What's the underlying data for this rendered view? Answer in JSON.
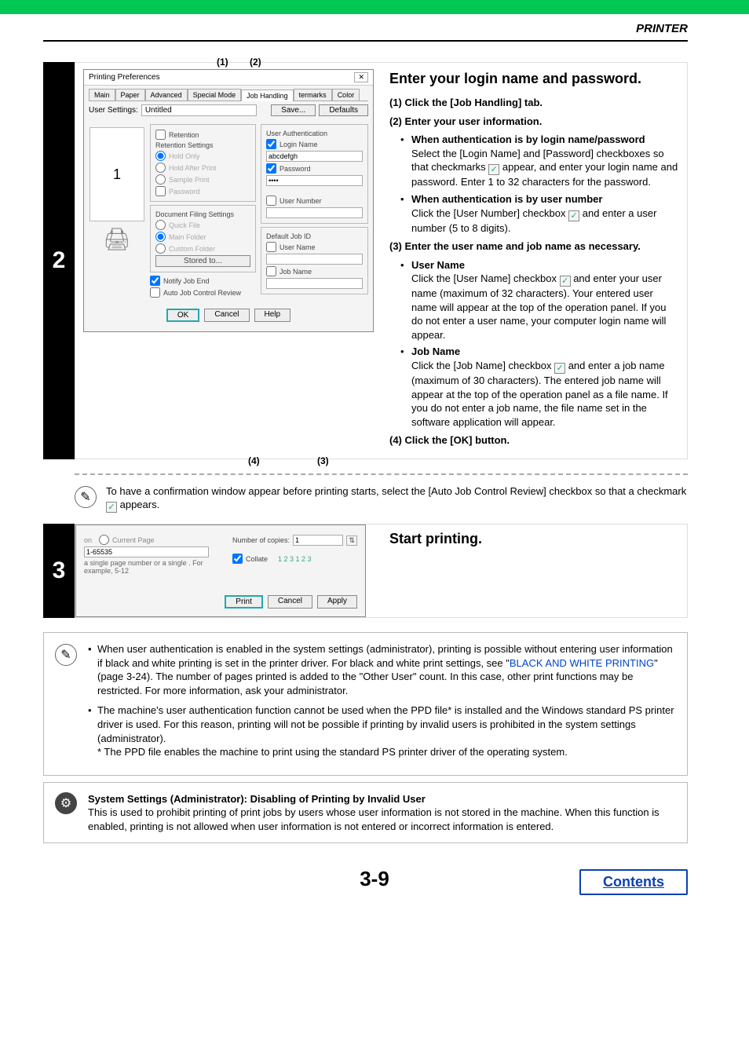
{
  "header": {
    "section": "PRINTER"
  },
  "step2": {
    "number": "2",
    "callouts": {
      "c1": "(1)",
      "c2": "(2)",
      "c3": "(3)",
      "c4": "(4)"
    },
    "dialog": {
      "title": "Printing Preferences",
      "tabs": [
        "Main",
        "Paper",
        "Advanced",
        "Special Mode",
        "Job Handling",
        "termarks",
        "Color"
      ],
      "activeTab": "Job Handling",
      "userSettingsLabel": "User Settings:",
      "userSettingsValue": "Untitled",
      "saveBtn": "Save...",
      "defaultsBtn": "Defaults",
      "previewNum": "1",
      "retentionGroup": {
        "retention": "Retention",
        "settings": "Retention Settings",
        "holdOnly": "Hold Only",
        "holdAfter": "Hold After Print",
        "sample": "Sample Print",
        "password": "Password"
      },
      "docFiling": {
        "title": "Document Filing Settings",
        "quick": "Quick File",
        "main": "Main Folder",
        "custom": "Custom Folder",
        "storedTo": "Stored to..."
      },
      "notify": "Notify Job End",
      "autoReview": "Auto Job Control Review",
      "userAuth": {
        "title": "User Authentication",
        "loginName": "Login Name",
        "loginVal": "abcdefgh",
        "password": "Password",
        "passVal": "••••",
        "userNumber": "User Number"
      },
      "defaultJob": {
        "title": "Default Job ID",
        "userName": "User Name",
        "jobName": "Job Name"
      },
      "ok": "OK",
      "cancel": "Cancel",
      "help": "Help"
    },
    "title": "Enter your login name and password.",
    "i1": {
      "num": "(1)",
      "txt": "Click the [Job Handling] tab."
    },
    "i2": {
      "num": "(2)",
      "txt": "Enter your user information."
    },
    "b1": {
      "t": "When authentication is by login name/password",
      "body": "Select the [Login Name] and [Password] checkboxes so that checkmarks ",
      "body2": " appear, and enter your login name and password. Enter 1 to 32 characters for the password."
    },
    "b2": {
      "t": "When authentication is by user number",
      "body": "Click the [User Number] checkbox ",
      "body2": " and enter a user number (5 to 8 digits)."
    },
    "i3": {
      "num": "(3)",
      "txt": "Enter the user name and job name as necessary."
    },
    "b3": {
      "t": "User Name",
      "body": "Click the [User Name] checkbox ",
      "body2": " and enter your user name (maximum of 32 characters). Your entered user name will appear at the top of the operation panel. If you do not enter a user name, your computer login name will appear."
    },
    "b4": {
      "t": "Job Name",
      "body": "Click the [Job Name] checkbox ",
      "body2": " and enter a job name (maximum of 30 characters). The entered job name will appear at the top of the operation panel as a file name. If you do not enter a job name, the file name set in the software application will appear."
    },
    "i4": {
      "num": "(4)",
      "txt": "Click the [OK] button."
    },
    "note": {
      "a": "To have a confirmation window appear before printing starts, select the [Auto Job Control Review] checkbox so that a checkmark ",
      "b": " appears."
    }
  },
  "step3": {
    "number": "3",
    "title": "Start printing.",
    "dlg": {
      "currentPage": "Current Page",
      "range": "1-65535",
      "rangeHelp": "a single page number or a single . For example, 5-12",
      "copiesLbl": "Number of copies:",
      "copiesVal": "1",
      "collate": "Collate",
      "icons": "1 2 3   1 2 3",
      "print": "Print",
      "cancel": "Cancel",
      "apply": "Apply"
    }
  },
  "infoBox": {
    "p1a": "When user authentication is enabled in the system settings (administrator), printing is possible without entering user information if black and white printing is set in the printer driver. For black and white print settings, see \"",
    "link": "BLACK AND WHITE PRINTING",
    "p1b": "\" (page 3-24). The number of pages printed is added to the \"Other User\" count. In this case, other print functions may be restricted. For more information, ask your administrator.",
    "p2": "The machine's user authentication function cannot be used when the PPD file* is installed and the Windows standard PS printer driver is used. For this reason, printing will not be possible if printing by invalid users is prohibited in the system settings (administrator).",
    "p2foot": "* The PPD file enables the machine to print using the standard PS printer driver of the operating system."
  },
  "gearBox": {
    "title": "System Settings (Administrator): Disabling of Printing by Invalid User",
    "body": "This is used to prohibit printing of print jobs by users whose user information is not stored in the machine. When this function is enabled, printing is not allowed when user information is not entered or incorrect information is entered."
  },
  "pageNumber": "3-9",
  "contents": "Contents",
  "check": "✓"
}
